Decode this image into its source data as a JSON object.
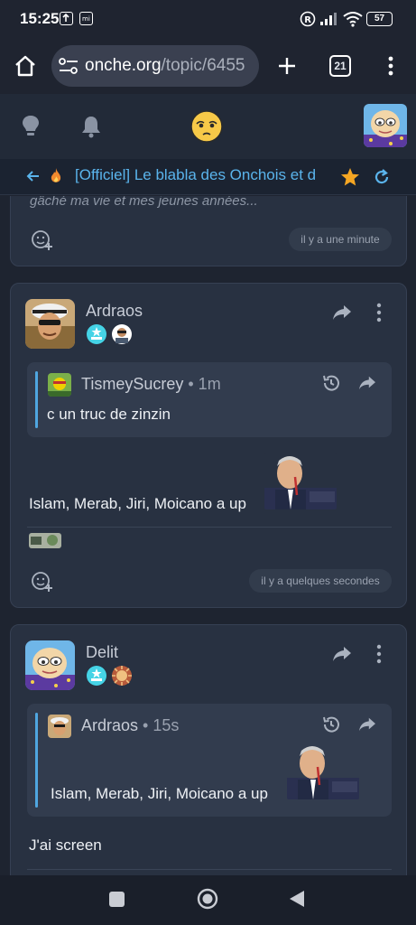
{
  "status_bar": {
    "time": "15:25",
    "battery": "57"
  },
  "browser": {
    "url_main": "onche.org",
    "url_path": "/topic/6455",
    "tab_count": "21"
  },
  "topic": {
    "title": "[Officiel] Le blabla des Onchois et d"
  },
  "posts": [
    {
      "body_partial": "gâché ma vie et mes jeunes années...",
      "time": "il y a une minute"
    },
    {
      "author": "Ardraos",
      "quote": {
        "author": "TismeySucrey",
        "time": "• 1m",
        "text": "c un truc de zinzin"
      },
      "body": "Islam, Merab, Jiri, Moicano a up",
      "time": "il y a quelques secondes"
    },
    {
      "author": "Delit",
      "quote": {
        "author": "Ardraos",
        "time": "• 15s",
        "text": "Islam, Merab, Jiri, Moicano a up"
      },
      "body": "J'ai screen"
    }
  ],
  "colors": {
    "accent": "#5ab4ec",
    "star": "#f5a623",
    "background": "#1e2430",
    "card": "#283141"
  }
}
